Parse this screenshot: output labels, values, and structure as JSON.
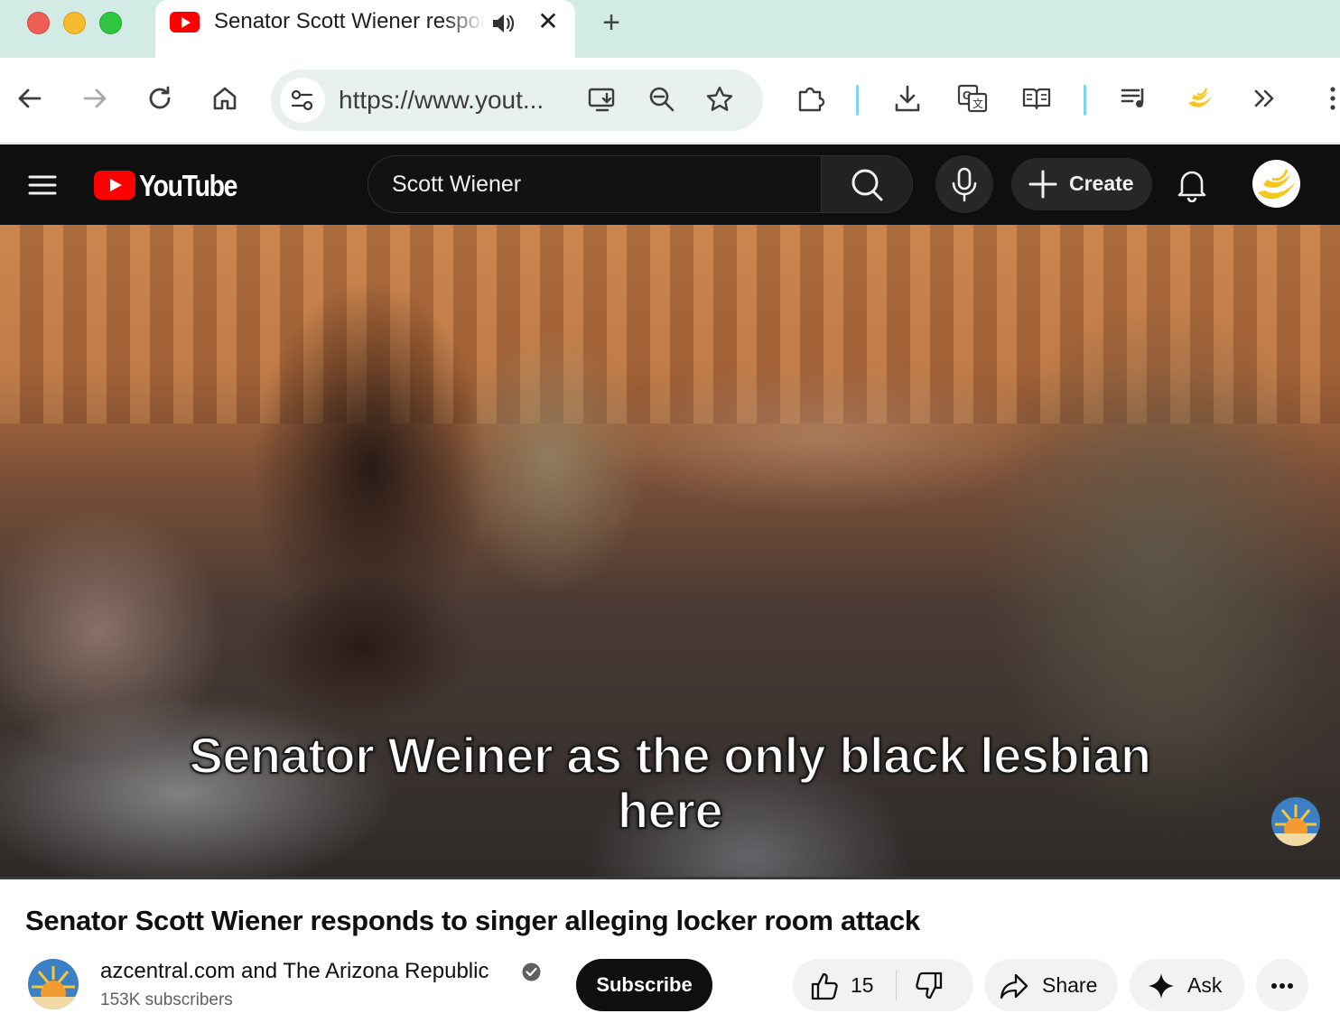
{
  "browser": {
    "tab": {
      "title": "Senator Scott Wiener responds to singer alleging locker room attack",
      "close_glyph": "✕"
    },
    "new_tab_glyph": "+",
    "address": {
      "url": "https://www.yout..."
    },
    "icons": [
      "back-arrow-icon",
      "forward-arrow-icon",
      "reload-icon",
      "home-icon",
      "site-settings-icon",
      "install-app-icon",
      "zoom-icon",
      "bookmark-star-icon",
      "extensions-icon",
      "download-icon",
      "translate-icon",
      "reading-mode-icon",
      "reading-list-icon",
      "profile-extension-icon",
      "overflow-chevrons-icon",
      "more-menu-icon"
    ],
    "accent_separator_color": "#7fd6e4",
    "tabbar_color": "#d3ebe5"
  },
  "youtube": {
    "logo_text": "YouTube",
    "search": {
      "value": "Scott Wiener"
    },
    "create_label": "Create",
    "brand_color": "#ff0000"
  },
  "video": {
    "subtitle_line1": "Senator Weiner as the only black lesbian",
    "subtitle_line2": "here",
    "title": "Senator Scott Wiener responds to singer alleging locker room attack"
  },
  "channel": {
    "name": "azcentral.com and The Arizona Republic",
    "subscribers": "153K subscribers",
    "verified": true,
    "subscribe_label": "Subscribe"
  },
  "actions": {
    "like_count": "15",
    "share_label": "Share",
    "ask_label": "Ask"
  }
}
